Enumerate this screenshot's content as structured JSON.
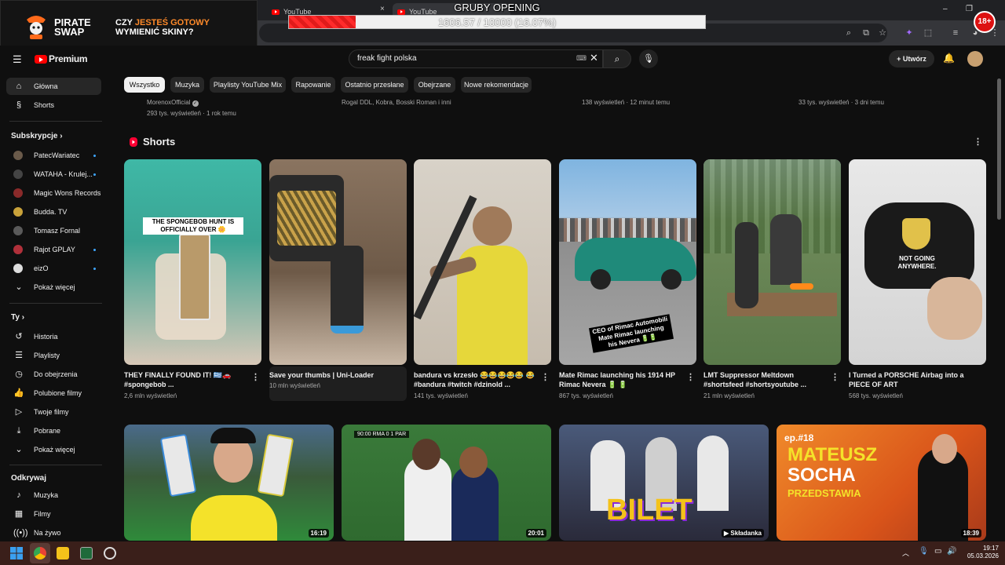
{
  "overlay": {
    "brand_line1": "PIRATE",
    "brand_line2": "SWAP",
    "promo_line1_a": "CZY ",
    "promo_line1_b": "JESTEŚ GOTOWY",
    "promo_line2": "WYMIENIĆ SKINY?",
    "stream_title": "GRUBY OPENING",
    "progress_text": "1606.57 / 10000 (16.07%)",
    "progress_fraction": 0.1607,
    "age_badge": "18+"
  },
  "browser": {
    "tabs": [
      {
        "label": "YouTube"
      },
      {
        "label": "YouTube"
      }
    ],
    "close_glyph": "×"
  },
  "header": {
    "logo_text": "Premium",
    "search_value": "freak fight polska",
    "create_label": "Utwórz"
  },
  "chips": [
    "Wszystko",
    "Muzyka",
    "Playlisty YouTube Mix",
    "Rapowanie",
    "Ostatnio przesłane",
    "Obejrzane",
    "Nowe rekomendacje"
  ],
  "sidebar": {
    "main": [
      {
        "label": "Główna"
      },
      {
        "label": "Shorts"
      }
    ],
    "subs_heading": "Subskrypcje",
    "subs": [
      {
        "label": "PatecWariatec",
        "color": "#6a5a4a"
      },
      {
        "label": "WATAHA - Kruleј...",
        "color": "#444444"
      },
      {
        "label": "Magic Wons Records",
        "color": "#8a2a2a"
      },
      {
        "label": "Budda. TV",
        "color": "#c9a23a"
      },
      {
        "label": "Tomasz Fornal",
        "color": "#5a5a5a"
      },
      {
        "label": "Rajot GPLAY",
        "color": "#b0303a"
      },
      {
        "label": "eizO",
        "color": "#dddddd"
      }
    ],
    "show_more": "Pokaż więcej",
    "you_heading": "Ty",
    "you": [
      {
        "label": "Historia"
      },
      {
        "label": "Playlisty"
      },
      {
        "label": "Do obejrzenia"
      },
      {
        "label": "Polubione filmy"
      },
      {
        "label": "Twoje filmy"
      },
      {
        "label": "Pobrane"
      },
      {
        "label": "Pokaż więcej"
      }
    ],
    "explore_heading": "Odkrywaj",
    "explore": [
      {
        "label": "Muzyka"
      },
      {
        "label": "Filmy"
      },
      {
        "label": "Na żywo"
      }
    ]
  },
  "top_meta": {
    "channel": "MorenoxOfficial",
    "views1": "293 tys. wyświetleń · 1 rok temu",
    "artists": "Rogal DDL, Kobra, Bosski Roman i inni",
    "views2": "138 wyświetleń · 12 minut temu",
    "views3": "33 tys. wyświetleń · 3 dni temu"
  },
  "shorts": {
    "heading": "Shorts",
    "items": [
      {
        "title": "THEY FINALLY FOUND IT! 🇬🇷🚗 #spongebob ...",
        "views": "2,6 mln wyświetleń",
        "caption": "THE SPONGEBOB HUNT IS OFFICIALLY OVER 🌼",
        "bg": "#4bb8a9"
      },
      {
        "title": "Save your thumbs | Uni-Loader",
        "views": "10 mln wyświetleń",
        "caption": "",
        "bg": "#7a6a5a"
      },
      {
        "title": "bandura vs krzesło 😂😂😂😂😂 😂 #bandura #twitch #dzinold ...",
        "views": "141 tys. wyświetleń",
        "caption": "",
        "bg": "#c9c1b6"
      },
      {
        "title": "Mate Rimac launching his 1914 HP Rimac Nevera 🔋 🔋",
        "views": "867 tys. wyświetleń",
        "caption": "CEO of Rimac Automobili Mate Rimac launching his Nevera 🔋🔋",
        "bg": "#7aa6c9"
      },
      {
        "title": "LMT Suppressor Meltdown #shortsfeed #shortsyoutube ...",
        "views": "21 mln wyświetleń",
        "caption": "",
        "bg": "#6f8a5a"
      },
      {
        "title": "I Turned a PORSCHE Airbag into a PIECE OF ART",
        "views": "568 tys. wyświetleń",
        "caption": "NOT GOING ANYWHERE.",
        "bg": "#d9d9d9"
      }
    ]
  },
  "videos": [
    {
      "duration": "16:19",
      "bg": "#3a6a3a"
    },
    {
      "duration": "20:01",
      "bg": "#2f6a2f",
      "score": "90:00  RMA  0  1  PAR"
    },
    {
      "duration": "Składanka",
      "bg": "#2a2a3a",
      "text": "BILET"
    },
    {
      "duration": "18:39",
      "bg": "#d95a1a",
      "ep": "ep.#18",
      "name1": "MATEUSZ",
      "name2": "SOCHA",
      "sub": "PRZEDSTAWIA"
    }
  ],
  "taskbar": {
    "time": "19:17",
    "date": "05.03.2026"
  }
}
